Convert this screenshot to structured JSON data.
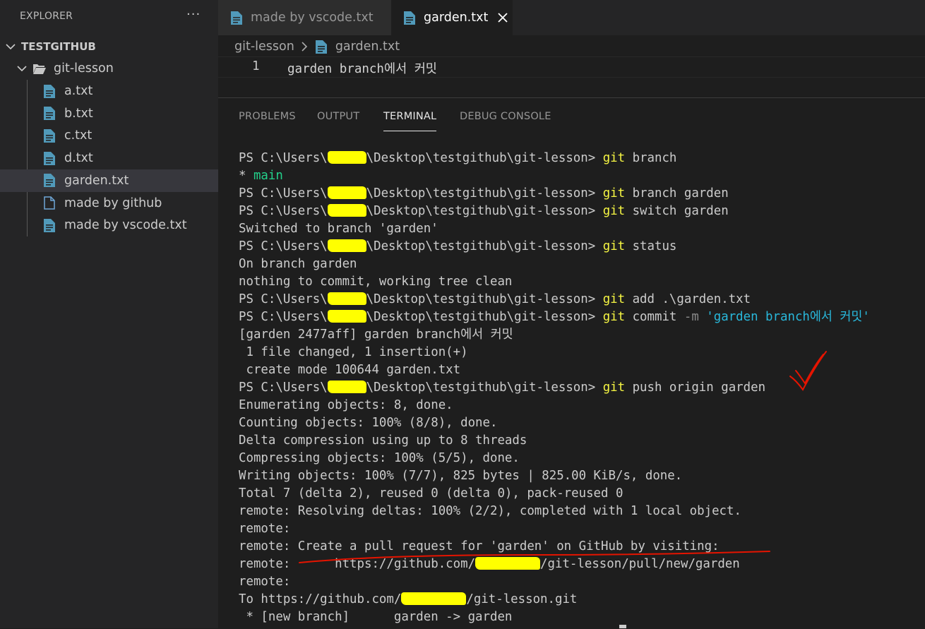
{
  "sidebar": {
    "title": "EXPLORER",
    "more_label": "···",
    "root": "TESTGITHUB",
    "folder": "git-lesson",
    "files": [
      {
        "name": "a.txt",
        "icon": "text-file-icon"
      },
      {
        "name": "b.txt",
        "icon": "text-file-icon"
      },
      {
        "name": "c.txt",
        "icon": "text-file-icon"
      },
      {
        "name": "d.txt",
        "icon": "text-file-icon"
      },
      {
        "name": "garden.txt",
        "icon": "text-file-icon",
        "selected": true
      },
      {
        "name": "made by github",
        "icon": "blank-file-icon"
      },
      {
        "name": "made by vscode.txt",
        "icon": "text-file-icon"
      }
    ]
  },
  "tabs": [
    {
      "label": "made by vscode.txt",
      "active": false
    },
    {
      "label": "garden.txt",
      "active": true
    }
  ],
  "breadcrumb": [
    "git-lesson",
    "garden.txt"
  ],
  "editor": {
    "line_number": "1",
    "text": "garden branch에서 커밋"
  },
  "panel_tabs": [
    "PROBLEMS",
    "OUTPUT",
    "TERMINAL",
    "DEBUG CONSOLE"
  ],
  "active_panel_tab": "TERMINAL",
  "colors": {
    "accent_file_icon": "#519aba",
    "git_command": "#f5f543",
    "branch_main": "#23d18b",
    "string": "#29b8db",
    "redaction": "#ffff00",
    "annotation": "#e51400"
  },
  "terminal": {
    "prompt_prefix": "PS C:\\Users\\",
    "prompt_suffix": "\\Desktop\\testgithub\\git-lesson> ",
    "lines": [
      {
        "type": "prompt",
        "git": "git",
        "args": " branch"
      },
      {
        "type": "main",
        "star": "* ",
        "branch": "main"
      },
      {
        "type": "prompt",
        "git": "git",
        "args": " branch garden"
      },
      {
        "type": "prompt",
        "git": "git",
        "args": " switch garden"
      },
      {
        "type": "out",
        "text": "Switched to branch 'garden'"
      },
      {
        "type": "prompt",
        "git": "git",
        "args": " status"
      },
      {
        "type": "out",
        "text": "On branch garden"
      },
      {
        "type": "out",
        "text": "nothing to commit, working tree clean"
      },
      {
        "type": "prompt",
        "git": "git",
        "args": " add .\\garden.txt"
      },
      {
        "type": "commit",
        "git": "git",
        "args": " commit ",
        "flag": "-m",
        "str": " 'garden branch에서 커밋'"
      },
      {
        "type": "out",
        "text": "[garden 2477aff] garden branch에서 커밋"
      },
      {
        "type": "out",
        "text": " 1 file changed, 1 insertion(+)"
      },
      {
        "type": "out",
        "text": " create mode 100644 garden.txt"
      },
      {
        "type": "prompt",
        "git": "git",
        "args": " push origin garden"
      },
      {
        "type": "out",
        "text": "Enumerating objects: 8, done."
      },
      {
        "type": "out",
        "text": "Counting objects: 100% (8/8), done."
      },
      {
        "type": "out",
        "text": "Delta compression using up to 8 threads"
      },
      {
        "type": "out",
        "text": "Compressing objects: 100% (5/5), done."
      },
      {
        "type": "out",
        "text": "Writing objects: 100% (7/7), 825 bytes | 825.00 KiB/s, done."
      },
      {
        "type": "out",
        "text": "Total 7 (delta 2), reused 0 (delta 0), pack-reused 0"
      },
      {
        "type": "out",
        "text": "remote: Resolving deltas: 100% (2/2), completed with 1 local object."
      },
      {
        "type": "out",
        "text": "remote:"
      },
      {
        "type": "out",
        "text": "remote: Create a pull request for 'garden' on GitHub by visiting:"
      },
      {
        "type": "url",
        "pre": "remote:      https://github.com/",
        "post": "/git-lesson/pull/new/garden"
      },
      {
        "type": "out",
        "text": "remote:"
      },
      {
        "type": "url",
        "pre": "To https://github.com/",
        "post": "/git-lesson.git"
      },
      {
        "type": "out",
        "text": " * [new branch]      garden -> garden"
      }
    ]
  }
}
